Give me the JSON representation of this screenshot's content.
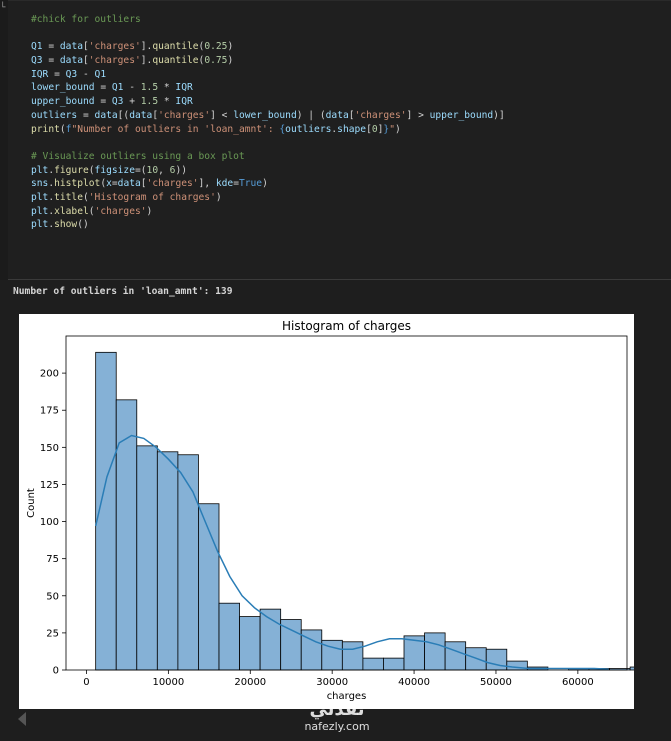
{
  "code_lines": [
    [
      [
        "c-com",
        "#chick for outliers"
      ]
    ],
    [],
    [
      [
        "c-var",
        "Q1"
      ],
      [
        "c-op",
        " = "
      ],
      [
        "c-var",
        "data"
      ],
      [
        "c-op",
        "["
      ],
      [
        "c-str",
        "'charges'"
      ],
      [
        "c-op",
        "]."
      ],
      [
        "c-fn",
        "quantile"
      ],
      [
        "c-op",
        "("
      ],
      [
        "c-num",
        "0.25"
      ],
      [
        "c-op",
        ")"
      ]
    ],
    [
      [
        "c-var",
        "Q3"
      ],
      [
        "c-op",
        " = "
      ],
      [
        "c-var",
        "data"
      ],
      [
        "c-op",
        "["
      ],
      [
        "c-str",
        "'charges'"
      ],
      [
        "c-op",
        "]."
      ],
      [
        "c-fn",
        "quantile"
      ],
      [
        "c-op",
        "("
      ],
      [
        "c-num",
        "0.75"
      ],
      [
        "c-op",
        ")"
      ]
    ],
    [
      [
        "c-var",
        "IQR"
      ],
      [
        "c-op",
        " = "
      ],
      [
        "c-var",
        "Q3"
      ],
      [
        "c-op",
        " - "
      ],
      [
        "c-var",
        "Q1"
      ]
    ],
    [
      [
        "c-var",
        "lower_bound"
      ],
      [
        "c-op",
        " = "
      ],
      [
        "c-var",
        "Q1"
      ],
      [
        "c-op",
        " - "
      ],
      [
        "c-num",
        "1.5"
      ],
      [
        "c-op",
        " * "
      ],
      [
        "c-var",
        "IQR"
      ]
    ],
    [
      [
        "c-var",
        "upper_bound"
      ],
      [
        "c-op",
        " = "
      ],
      [
        "c-var",
        "Q3"
      ],
      [
        "c-op",
        " + "
      ],
      [
        "c-num",
        "1.5"
      ],
      [
        "c-op",
        " * "
      ],
      [
        "c-var",
        "IQR"
      ]
    ],
    [
      [
        "c-var",
        "outliers"
      ],
      [
        "c-op",
        " = "
      ],
      [
        "c-var",
        "data"
      ],
      [
        "c-op",
        "[("
      ],
      [
        "c-var",
        "data"
      ],
      [
        "c-op",
        "["
      ],
      [
        "c-str",
        "'charges'"
      ],
      [
        "c-op",
        "] < "
      ],
      [
        "c-var",
        "lower_bound"
      ],
      [
        "c-op",
        ") | ("
      ],
      [
        "c-var",
        "data"
      ],
      [
        "c-op",
        "["
      ],
      [
        "c-str",
        "'charges'"
      ],
      [
        "c-op",
        "] > "
      ],
      [
        "c-var",
        "upper_bound"
      ],
      [
        "c-op",
        ")]"
      ]
    ],
    [
      [
        "c-fn",
        "print"
      ],
      [
        "c-op",
        "("
      ],
      [
        "c-kw",
        "f"
      ],
      [
        "c-str",
        "\"Number of outliers in 'loan_amnt': "
      ],
      [
        "c-kw",
        "{"
      ],
      [
        "c-var",
        "outliers"
      ],
      [
        "c-op",
        "."
      ],
      [
        "c-var",
        "shape"
      ],
      [
        "c-op",
        "["
      ],
      [
        "c-num",
        "0"
      ],
      [
        "c-op",
        "]"
      ],
      [
        "c-kw",
        "}"
      ],
      [
        "c-str",
        "\""
      ],
      [
        "c-op",
        ")"
      ]
    ],
    [],
    [
      [
        "c-com",
        "# Visualize outliers using a box plot"
      ]
    ],
    [
      [
        "c-var",
        "plt"
      ],
      [
        "c-op",
        "."
      ],
      [
        "c-fn",
        "figure"
      ],
      [
        "c-op",
        "("
      ],
      [
        "c-var",
        "figsize"
      ],
      [
        "c-op",
        "=("
      ],
      [
        "c-num",
        "10"
      ],
      [
        "c-op",
        ", "
      ],
      [
        "c-num",
        "6"
      ],
      [
        "c-op",
        "))"
      ]
    ],
    [
      [
        "c-var",
        "sns"
      ],
      [
        "c-op",
        "."
      ],
      [
        "c-fn",
        "histplot"
      ],
      [
        "c-op",
        "("
      ],
      [
        "c-var",
        "x"
      ],
      [
        "c-op",
        "="
      ],
      [
        "c-var",
        "data"
      ],
      [
        "c-op",
        "["
      ],
      [
        "c-str",
        "'charges'"
      ],
      [
        "c-op",
        "], "
      ],
      [
        "c-var",
        "kde"
      ],
      [
        "c-op",
        "="
      ],
      [
        "c-kw",
        "True"
      ],
      [
        "c-op",
        ")"
      ]
    ],
    [
      [
        "c-var",
        "plt"
      ],
      [
        "c-op",
        "."
      ],
      [
        "c-fn",
        "title"
      ],
      [
        "c-op",
        "("
      ],
      [
        "c-str",
        "'Histogram of charges'"
      ],
      [
        "c-op",
        ")"
      ]
    ],
    [
      [
        "c-var",
        "plt"
      ],
      [
        "c-op",
        "."
      ],
      [
        "c-fn",
        "xlabel"
      ],
      [
        "c-op",
        "("
      ],
      [
        "c-str",
        "'charges'"
      ],
      [
        "c-op",
        ")"
      ]
    ],
    [
      [
        "c-var",
        "plt"
      ],
      [
        "c-op",
        "."
      ],
      [
        "c-fn",
        "show"
      ],
      [
        "c-op",
        "()"
      ]
    ]
  ],
  "output": {
    "text": "Number of outliers in 'loan_amnt': 139"
  },
  "watermark": {
    "logo": "نفذلي",
    "text": "nafezly.com"
  },
  "chart_data": {
    "type": "bar",
    "title": "Histogram of charges",
    "xlabel": "charges",
    "ylabel": "Count",
    "xlim": [
      -2500,
      66000
    ],
    "ylim": [
      0,
      225
    ],
    "xticks": [
      0,
      10000,
      20000,
      30000,
      40000,
      50000,
      60000
    ],
    "yticks": [
      0,
      25,
      50,
      75,
      100,
      125,
      150,
      175,
      200
    ],
    "bin_start": 1122,
    "bin_width": 2510,
    "counts": [
      214,
      182,
      151,
      147,
      145,
      112,
      45,
      36,
      41,
      34,
      27,
      20,
      19,
      8,
      8,
      23,
      25,
      19,
      15,
      14,
      6,
      2,
      0,
      1,
      1,
      1,
      2
    ],
    "bar_color": "#7eadd4",
    "kde_color": "#2a7db6",
    "kde": [
      [
        1122,
        97
      ],
      [
        2500,
        130
      ],
      [
        4000,
        153
      ],
      [
        5500,
        158
      ],
      [
        7000,
        156
      ],
      [
        8500,
        150
      ],
      [
        10000,
        142
      ],
      [
        11500,
        133
      ],
      [
        13000,
        120
      ],
      [
        14500,
        100
      ],
      [
        16000,
        80
      ],
      [
        17500,
        63
      ],
      [
        19000,
        50
      ],
      [
        20500,
        42
      ],
      [
        22000,
        36
      ],
      [
        23500,
        31
      ],
      [
        25000,
        27
      ],
      [
        26500,
        23
      ],
      [
        28000,
        19
      ],
      [
        29500,
        16
      ],
      [
        31000,
        14
      ],
      [
        32500,
        14
      ],
      [
        34000,
        16
      ],
      [
        35500,
        19
      ],
      [
        37000,
        21
      ],
      [
        38500,
        21
      ],
      [
        40000,
        20
      ],
      [
        41500,
        19
      ],
      [
        43000,
        17
      ],
      [
        44500,
        14
      ],
      [
        46000,
        11
      ],
      [
        47500,
        8
      ],
      [
        49000,
        5
      ],
      [
        50500,
        3
      ],
      [
        52000,
        2
      ],
      [
        54000,
        1
      ],
      [
        56000,
        1
      ],
      [
        58000,
        1
      ],
      [
        60000,
        1
      ],
      [
        62000,
        1
      ],
      [
        63770,
        0.5
      ]
    ]
  }
}
